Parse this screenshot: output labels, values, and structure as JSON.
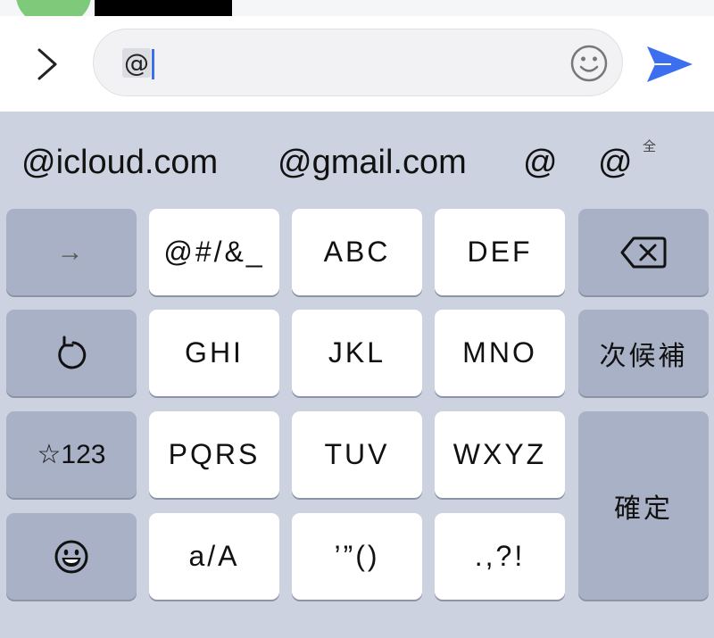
{
  "input": {
    "text": "@"
  },
  "keyboard": {
    "suggestions": [
      "@icloud.com",
      "@gmail.com",
      "@",
      "@"
    ],
    "zenkaku_mark": "全",
    "rows": [
      {
        "left": "→",
        "keys": [
          "@#/&_",
          "ABC",
          "DEF"
        ],
        "right": "delete"
      },
      {
        "left": "undo",
        "keys": [
          "GHI",
          "JKL",
          "MNO"
        ],
        "right": "次候補"
      },
      {
        "left": "☆123",
        "keys": [
          "PQRS",
          "TUV",
          "WXYZ"
        ],
        "right": "確定"
      },
      {
        "left": "emoji",
        "keys": [
          "a/A",
          "’”()",
          ".,?!"
        ]
      }
    ]
  },
  "icons": [
    "chevron-right-icon",
    "smiley-icon",
    "send-icon",
    "delete-icon",
    "undo-icon",
    "emoji-icon"
  ],
  "colors": {
    "accent": "#3b6ff0",
    "keyboard_bg": "#ccd2df",
    "function_key": "#a8b1c6",
    "letter_key": "#ffffff",
    "avatar": "#7fc97a"
  }
}
